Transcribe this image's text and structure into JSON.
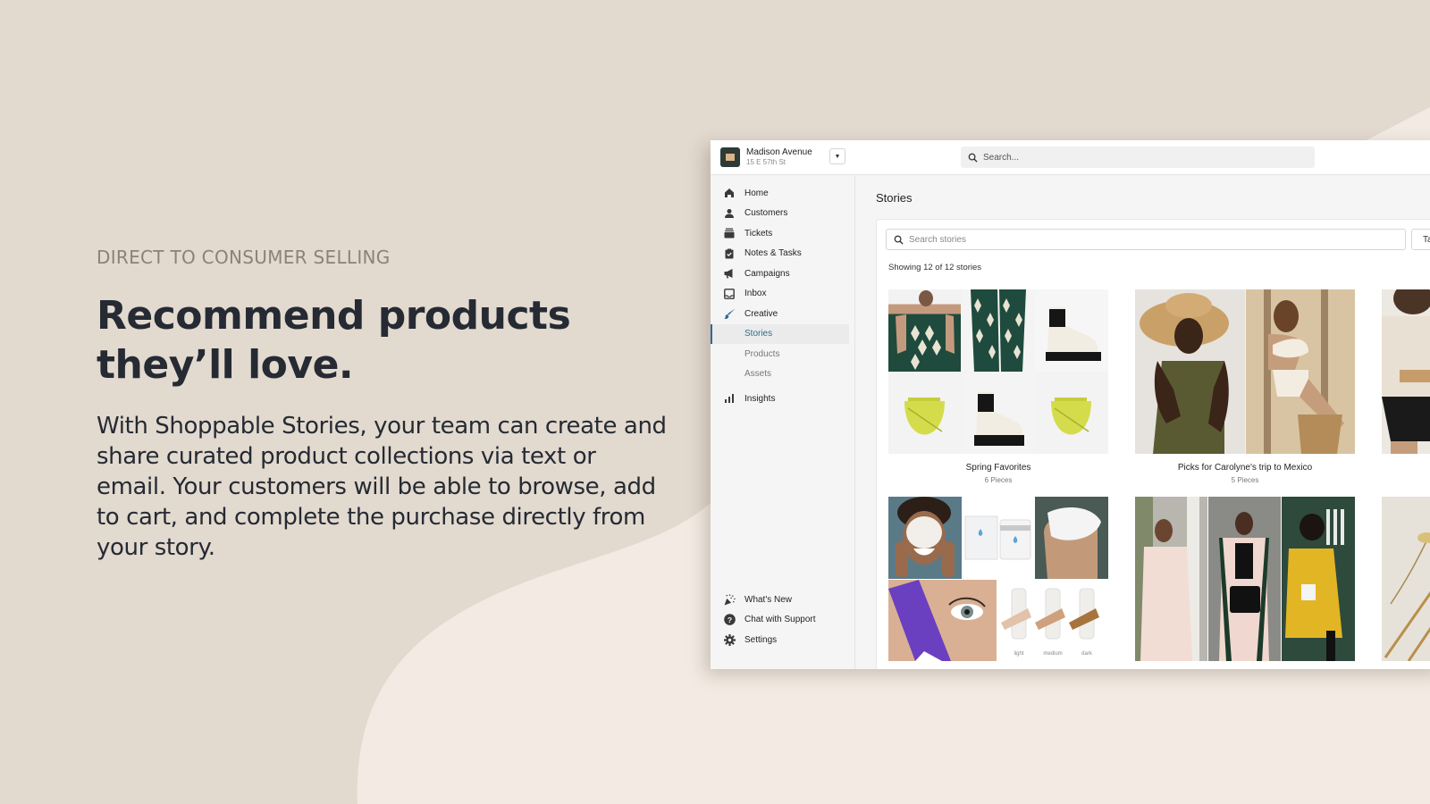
{
  "hero": {
    "eyebrow": "DIRECT TO CONSUMER SELLING",
    "headline_line1": "Recommend products",
    "headline_line2": "they’ll love.",
    "body": "With Shoppable Stories, your team can create and share curated product collections via text or email. Your customers will be able to browse, add to cart, and complete the purchase directly from your story."
  },
  "app": {
    "store": {
      "name": "Madison Avenue",
      "address": "15 E 57th St",
      "logo_icon": "store-logo-icon"
    },
    "global_search": {
      "placeholder": "Search..."
    },
    "sidebar": {
      "items": [
        {
          "label": "Home",
          "icon": "home-icon"
        },
        {
          "label": "Customers",
          "icon": "person-icon"
        },
        {
          "label": "Tickets",
          "icon": "tickets-icon"
        },
        {
          "label": "Notes & Tasks",
          "icon": "clipboard-check-icon"
        },
        {
          "label": "Campaigns",
          "icon": "megaphone-icon"
        },
        {
          "label": "Inbox",
          "icon": "inbox-icon"
        },
        {
          "label": "Creative",
          "icon": "paintbrush-icon"
        }
      ],
      "creative_subitems": [
        {
          "label": "Stories",
          "active": true
        },
        {
          "label": "Products",
          "active": false
        },
        {
          "label": "Assets",
          "active": false
        }
      ],
      "insights": {
        "label": "Insights",
        "icon": "bar-chart-icon"
      },
      "bottom_items": [
        {
          "label": "What's New",
          "icon": "party-popper-icon"
        },
        {
          "label": "Chat with Support",
          "icon": "help-circle-icon"
        },
        {
          "label": "Settings",
          "icon": "gear-icon"
        }
      ]
    },
    "main": {
      "title": "Stories",
      "search_placeholder": "Search stories",
      "tags_button": "Tags",
      "count_text": "Showing 12 of 12 stories",
      "stories": [
        {
          "title": "Spring Favorites",
          "pieces": "6 Pieces"
        },
        {
          "title": "Picks for Carolyne's trip to Mexico",
          "pieces": "5 Pieces"
        }
      ]
    },
    "colors": {
      "accent": "#2f6b90",
      "background": "#e2d9cf",
      "wave": "#f3ebe3"
    }
  }
}
